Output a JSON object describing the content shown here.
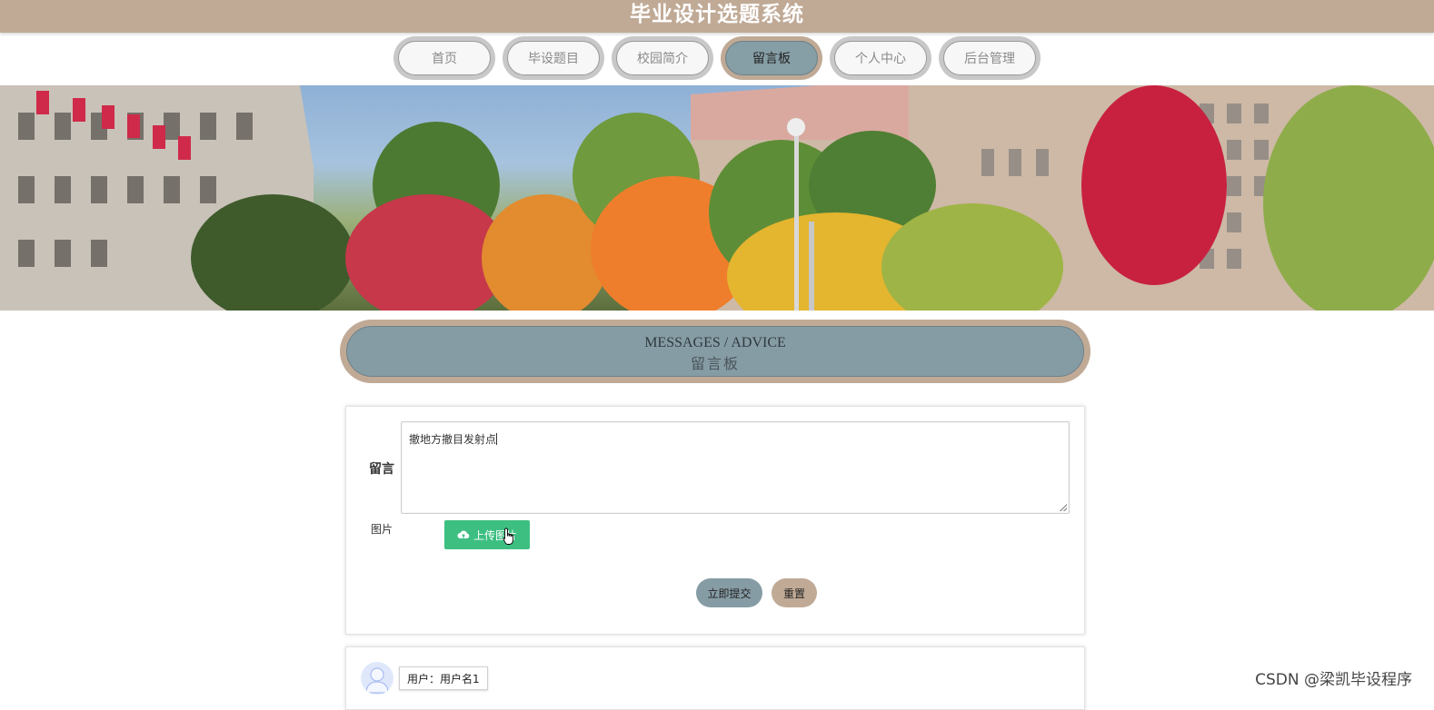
{
  "header": {
    "title": "毕业设计选题系统"
  },
  "nav": {
    "items": [
      {
        "label": "首页",
        "active": false
      },
      {
        "label": "毕设题目",
        "active": false
      },
      {
        "label": "校园简介",
        "active": false
      },
      {
        "label": "留言板",
        "active": true
      },
      {
        "label": "个人中心",
        "active": false
      },
      {
        "label": "后台管理",
        "active": false
      }
    ]
  },
  "section": {
    "title_en": "MESSAGES / ADVICE",
    "title_cn": "留言板"
  },
  "form": {
    "message_label": "留言",
    "message_value": "撤地方撤目发射点",
    "image_label": "图片",
    "upload_label": "上传图片",
    "submit_label": "立即提交",
    "reset_label": "重置"
  },
  "comments": [
    {
      "user": "用户：用户名1"
    }
  ],
  "watermark": "CSDN @梁凯毕设程序",
  "colors": {
    "topbar": "#c0aa96",
    "nav_active": "#869ea6",
    "upload_button": "#3dbf82"
  }
}
